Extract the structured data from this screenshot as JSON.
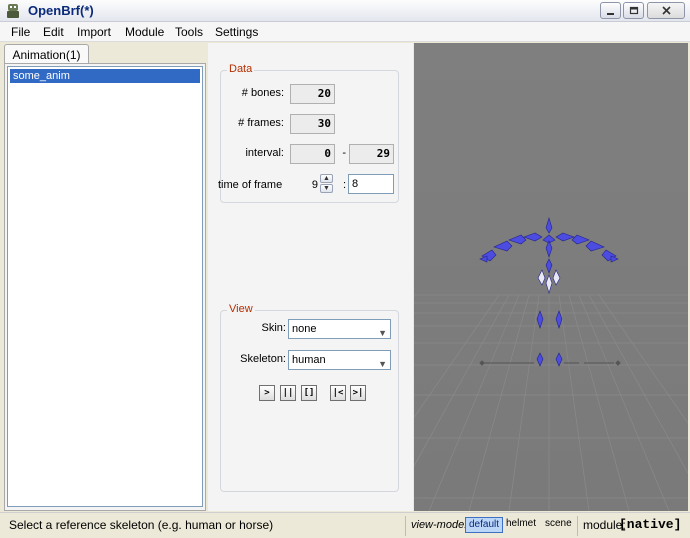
{
  "window": {
    "title": "OpenBrf(*)",
    "minimize_icon": "minimize-icon",
    "maximize_icon": "restore-icon",
    "close_icon": "close-icon"
  },
  "menu": [
    "File",
    "Edit",
    "Import",
    "Module",
    "Tools",
    "Settings"
  ],
  "tabs": [
    {
      "label": "Animation(1)"
    }
  ],
  "list": {
    "items": [
      "some_anim"
    ]
  },
  "data_group": {
    "title": "Data",
    "bones_label": "# bones:",
    "bones_value": "20",
    "frames_label": "# frames:",
    "frames_value": "30",
    "interval_label": "interval:",
    "interval_start": "0",
    "interval_sep": "-",
    "interval_end": "29",
    "time_label": "time of frame",
    "time_frame_value": "9",
    "time_sep": ":",
    "time_value": "8"
  },
  "view_group": {
    "title": "View",
    "skin_label": "Skin:",
    "skin_value": "none",
    "skeleton_label": "Skeleton:",
    "skeleton_value": "human",
    "playback_buttons": [
      ">",
      "||",
      "[]",
      "|<",
      ">|"
    ]
  },
  "status": {
    "message": "Select a reference skeleton (e.g. human or horse)",
    "view_mode_label": "view-mode:",
    "view_modes": [
      "default",
      "helmet",
      "scene"
    ],
    "active_view_mode": "default",
    "module_label": "module:",
    "module_value": "[native]"
  },
  "colors": {
    "accent": "#316ac5",
    "group_title": "#b42e00",
    "viewport": "#7d7d7d",
    "bone": "#4c4ce0"
  }
}
